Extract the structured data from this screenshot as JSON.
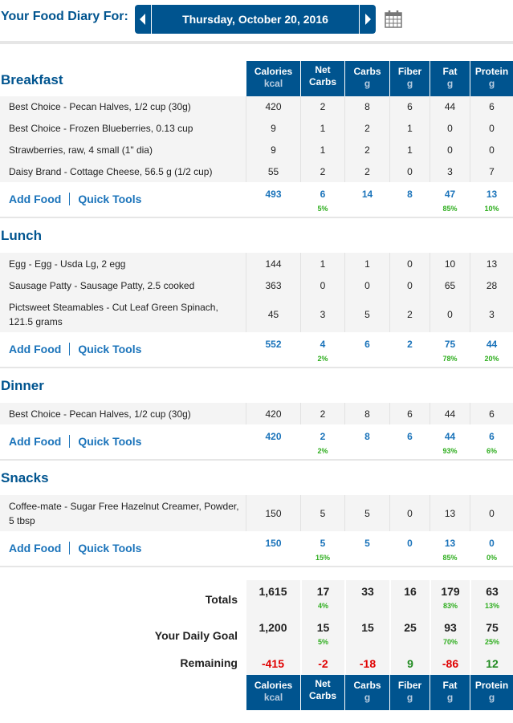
{
  "header": {
    "title": "Your Food Diary For:",
    "date": "Thursday, October 20, 2016",
    "prev_icon": "caret-left-icon",
    "next_icon": "caret-right-icon",
    "calendar_icon": "calendar-icon"
  },
  "columns": [
    {
      "name": "Calories",
      "unit": "kcal"
    },
    {
      "name": "Net",
      "unit": "Carbs"
    },
    {
      "name": "Carbs",
      "unit": "g"
    },
    {
      "name": "Fiber",
      "unit": "g"
    },
    {
      "name": "Fat",
      "unit": "g"
    },
    {
      "name": "Protein",
      "unit": "g"
    }
  ],
  "links": {
    "add_food": "Add Food",
    "quick_tools": "Quick Tools"
  },
  "meals": [
    {
      "title": "Breakfast",
      "foods": [
        {
          "name": "Best Choice - Pecan Halves, 1/2 cup (30g)",
          "values": [
            "420",
            "2",
            "8",
            "6",
            "44",
            "6"
          ]
        },
        {
          "name": "Best Choice - Frozen Blueberries, 0.13 cup",
          "values": [
            "9",
            "1",
            "2",
            "1",
            "0",
            "0"
          ]
        },
        {
          "name": "Strawberries, raw, 4 small (1\" dia)",
          "values": [
            "9",
            "1",
            "2",
            "1",
            "0",
            "0"
          ]
        },
        {
          "name": "Daisy Brand - Cottage Cheese, 56.5 g (1/2 cup)",
          "values": [
            "55",
            "2",
            "2",
            "0",
            "3",
            "7"
          ]
        }
      ],
      "totals": [
        "493",
        "6",
        "14",
        "8",
        "47",
        "13"
      ],
      "percents": [
        "",
        "5%",
        "",
        "",
        "85%",
        "10%"
      ]
    },
    {
      "title": "Lunch",
      "foods": [
        {
          "name": "Egg - Egg - Usda Lg, 2 egg",
          "values": [
            "144",
            "1",
            "1",
            "0",
            "10",
            "13"
          ]
        },
        {
          "name": "Sausage Patty - Sausage Patty, 2.5 cooked",
          "values": [
            "363",
            "0",
            "0",
            "0",
            "65",
            "28"
          ]
        },
        {
          "name": "Pictsweet Steamables - Cut Leaf Green Spinach, 121.5 grams",
          "values": [
            "45",
            "3",
            "5",
            "2",
            "0",
            "3"
          ]
        }
      ],
      "totals": [
        "552",
        "4",
        "6",
        "2",
        "75",
        "44"
      ],
      "percents": [
        "",
        "2%",
        "",
        "",
        "78%",
        "20%"
      ]
    },
    {
      "title": "Dinner",
      "foods": [
        {
          "name": "Best Choice - Pecan Halves, 1/2 cup (30g)",
          "values": [
            "420",
            "2",
            "8",
            "6",
            "44",
            "6"
          ]
        }
      ],
      "totals": [
        "420",
        "2",
        "8",
        "6",
        "44",
        "6"
      ],
      "percents": [
        "",
        "2%",
        "",
        "",
        "93%",
        "6%"
      ]
    },
    {
      "title": "Snacks",
      "foods": [
        {
          "name": "Coffee-mate - Sugar Free Hazelnut Creamer, Powder, 5 tbsp",
          "values": [
            "150",
            "5",
            "5",
            "0",
            "13",
            "0"
          ]
        }
      ],
      "totals": [
        "150",
        "5",
        "5",
        "0",
        "13",
        "0"
      ],
      "percents": [
        "",
        "15%",
        "",
        "",
        "85%",
        "0%"
      ]
    }
  ],
  "summary": {
    "totals": {
      "label": "Totals",
      "values": [
        "1,615",
        "17",
        "33",
        "16",
        "179",
        "63"
      ],
      "percents": [
        "",
        "4%",
        "",
        "",
        "83%",
        "13%"
      ]
    },
    "goal": {
      "label": "Your Daily Goal",
      "values": [
        "1,200",
        "15",
        "15",
        "25",
        "93",
        "75"
      ],
      "percents": [
        "",
        "5%",
        "",
        "",
        "70%",
        "25%"
      ]
    },
    "remaining": {
      "label": "Remaining",
      "values": [
        "-415",
        "-2",
        "-18",
        "9",
        "-86",
        "12"
      ],
      "status": [
        "neg",
        "neg",
        "neg",
        "pos",
        "neg",
        "pos"
      ]
    }
  },
  "colors": {
    "brand": "#00548f",
    "link": "#1a73ba",
    "percent": "#2fae1f",
    "over": "#e00000",
    "under": "#1f8a1f"
  }
}
